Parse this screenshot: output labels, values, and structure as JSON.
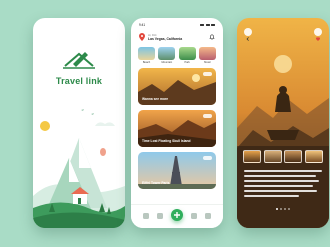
{
  "splash": {
    "brand": "Travel link",
    "logo_icon": "paper-plane-pen-icon"
  },
  "home": {
    "status_time": "9:41",
    "location_label": "Hi, Dirk",
    "location_value": "Las Vegas, California",
    "categories": [
      {
        "label": "Beach"
      },
      {
        "label": "Mountain"
      },
      {
        "label": "Park"
      },
      {
        "label": "Music"
      }
    ],
    "cards": [
      {
        "title": "Wanna see more"
      },
      {
        "title": "Time Lost Floating Skull Island"
      },
      {
        "title": "Eiffel Tower Paris"
      }
    ],
    "nav_icons": [
      "home-icon",
      "compass-icon",
      "add-icon",
      "bookmark-icon",
      "profile-icon"
    ]
  },
  "detail": {
    "thumb_count": 4,
    "active_dot": 0
  },
  "colors": {
    "background": "#a9dcc6",
    "brand_green": "#2d8a4a",
    "accent": "#2fae5c"
  }
}
